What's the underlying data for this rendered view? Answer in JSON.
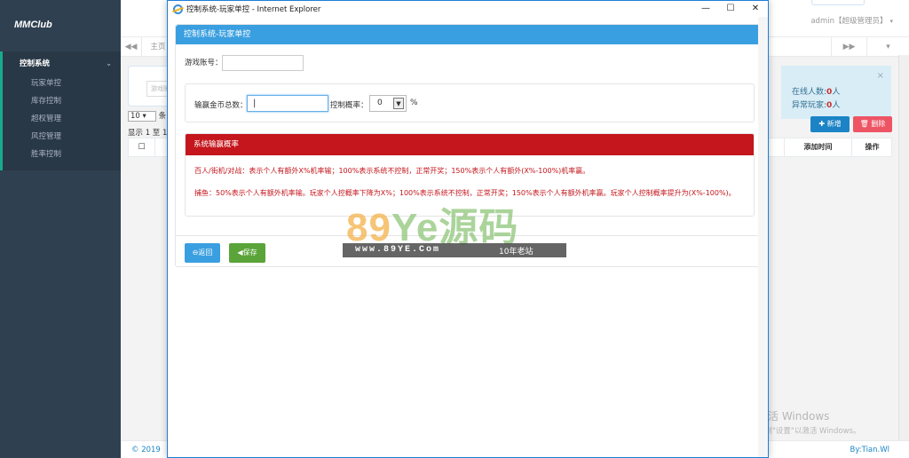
{
  "sidebar": {
    "brand": "MMClub",
    "group_label": "控制系统",
    "items": [
      {
        "label": "玩家单控"
      },
      {
        "label": "库存控制"
      },
      {
        "label": "超权管理"
      },
      {
        "label": "风控管理"
      },
      {
        "label": "胜率控制"
      }
    ]
  },
  "header": {
    "user": "admin【超级管理员】",
    "home_tab": "主页",
    "nav_left": "◀◀",
    "nav_right": "▶▶",
    "nav_drop": "▾"
  },
  "background": {
    "search_placeholder": "游戏账",
    "online_count_label": "在线人数:",
    "online_count": "0",
    "online_unit": "人",
    "abnormal_label": "异常玩家:",
    "abnormal_count": "0",
    "abnormal_unit": "人",
    "add_button": "✚ 新增",
    "delete_button": "🗑 删除",
    "page_size": "10",
    "page_size_suffix": "条",
    "show_info": "显示 1 至 1",
    "col_time": "添加时间",
    "col_op": "操作",
    "footer_copy": "© 2019",
    "footer_by": "By:Tian.Wl",
    "activate_title": "激活 Windows",
    "activate_sub": "转到\"设置\"以激活 Windows。"
  },
  "dialog": {
    "window_title": "控制系统-玩家单控 - Internet Explorer",
    "minimize": "—",
    "maximize": "☐",
    "close": "✕",
    "panel_title": "控制系统-玩家单控",
    "account_label": "游戏账号：",
    "account_value": "",
    "total_label": "输赢金币总数：",
    "total_value": "|",
    "rate_label": "控制概率：",
    "rate_value": "0",
    "rate_unit": "%",
    "rate_section_title": "系统输赢概率",
    "desc_line1": "百人/街机/对战：表示个人有额外X%机率输；100%表示系统不控制，正常开奖；150%表示个人有额外(X%-100%)机率赢。",
    "desc_line2": "捕鱼：50%表示个人有额外机率输。玩家个人控概率下降为X%；100%表示系统不控制，正常开奖；150%表示个人有额外机率赢。玩家个人控制概率提升为(X%-100%)。",
    "back_button": "⊖返回",
    "save_button": "◀保存"
  },
  "watermark": {
    "big_num": "89",
    "big_text": "Ye源码",
    "url": "www.89YE.Com",
    "tag": "10年老站"
  }
}
